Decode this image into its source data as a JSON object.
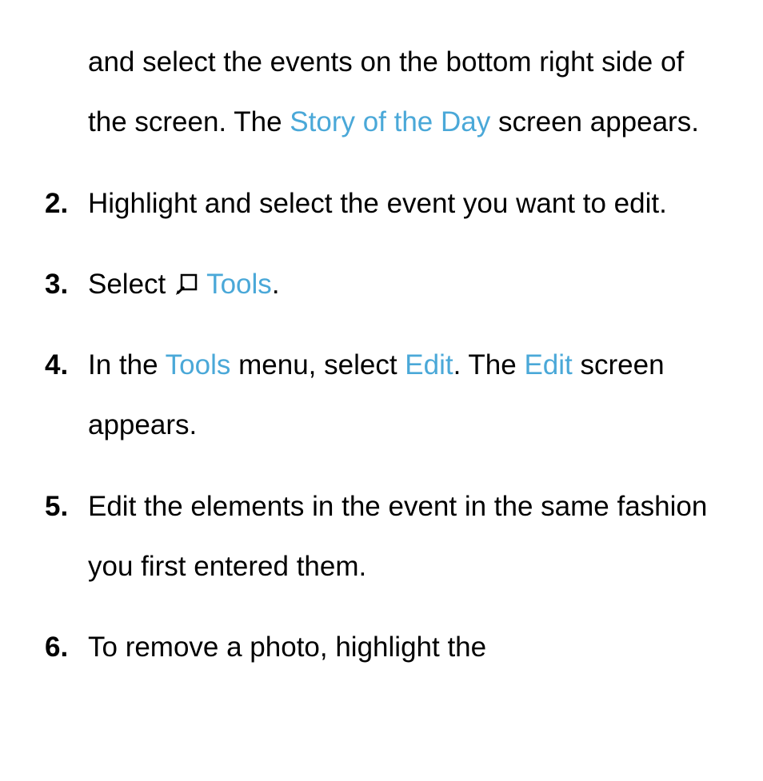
{
  "step1_continuation": {
    "part1": "and select the events on the bottom right side of the screen. The ",
    "link1": "Story of the Day",
    "part2": " screen appears."
  },
  "steps": [
    {
      "parts": [
        {
          "text": "Highlight and select the event you want to edit."
        }
      ]
    },
    {
      "parts": [
        {
          "text": "Select "
        },
        {
          "icon": "tools-icon"
        },
        {
          "text": " "
        },
        {
          "link": "Tools"
        },
        {
          "text": "."
        }
      ]
    },
    {
      "parts": [
        {
          "text": "In the "
        },
        {
          "link": "Tools"
        },
        {
          "text": " menu, select "
        },
        {
          "link": "Edit"
        },
        {
          "text": ". The "
        },
        {
          "link": "Edit"
        },
        {
          "text": " screen appears."
        }
      ]
    },
    {
      "parts": [
        {
          "text": "Edit the elements in the event in the same fashion you first entered them."
        }
      ]
    },
    {
      "parts": [
        {
          "text": "To remove a photo, highlight the"
        }
      ]
    }
  ]
}
